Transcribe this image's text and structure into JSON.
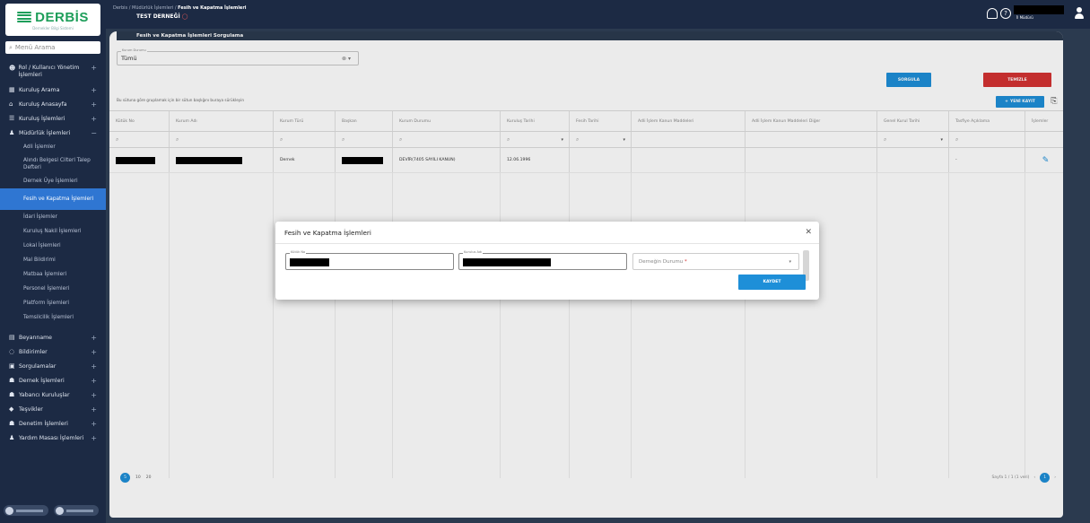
{
  "sidebar": {
    "logo_text": "DERBİS",
    "logo_sub": "Dernekler Bilgi Sistemi",
    "search_placeholder": "Menü Arama",
    "items": [
      {
        "label": "Rol / Kullanıcı Yönetim İşlemleri",
        "icon": "users-icon"
      },
      {
        "label": "Kuruluş Arama",
        "icon": "building-icon"
      },
      {
        "label": "Kuruluş Anasayfa",
        "icon": "home-icon"
      },
      {
        "label": "Kuruluş İşlemleri",
        "icon": "list-icon"
      },
      {
        "label": "Müdürlük İşlemleri",
        "icon": "person-icon"
      }
    ],
    "subitems": [
      "Adli İşlemler",
      "Alındı Belgesi Cilteri Talep Defteri",
      "Dernek Üye İşlemleri",
      "Fesih ve Kapatma İşlemleri",
      "İdari İşlemler",
      "Kuruluş Nakil İşlemleri",
      "Lokal İşlemleri",
      "Mal Bildirimi",
      "Matbaa İşlemleri",
      "Personel İşlemleri",
      "Platform İşlemleri",
      "Temsilcilik İşlemleri"
    ],
    "items2": [
      {
        "label": "Beyanname",
        "icon": "doc-icon"
      },
      {
        "label": "Bildirimler",
        "icon": "bell-icon"
      },
      {
        "label": "Sorgulamalar",
        "icon": "search-doc-icon"
      },
      {
        "label": "Dernek İşlemleri",
        "icon": "group-icon"
      },
      {
        "label": "Yabancı Kuruluşlar",
        "icon": "globe-icon"
      },
      {
        "label": "Teşvikler",
        "icon": "handshake-icon"
      },
      {
        "label": "Denetim İşlemleri",
        "icon": "audit-icon"
      },
      {
        "label": "Yardım Masası İşlemleri",
        "icon": "help-desk-icon"
      }
    ]
  },
  "topbar": {
    "breadcrumb_1": "Derbis",
    "breadcrumb_2": "Müdürlük İşlemleri",
    "breadcrumb_3": "Fesih ve Kapatma İşlemleri",
    "organization": "TEST DERNEĞİ",
    "user_role": "İl Müdürü"
  },
  "panel": {
    "title": "Fesih ve Kapatma İşlemleri Sorgulama",
    "filter_label": "Kurum Durumu",
    "filter_value": "Tümü",
    "sorgula_label": "SORGULA",
    "temizle_label": "TEMİZLE",
    "group_hint": "Bu sütuna göre gruplamak için bir sütun başlığını buraya sürükleyin",
    "yeni_kayit_label": "YENİ KAYIT"
  },
  "table": {
    "columns": [
      "Kütük No",
      "Kurum Adı",
      "Kurum Türü",
      "Başkan",
      "Kurum Durumu",
      "Kuruluş Tarihi",
      "Fesih Tarihi",
      "Adli İşlem Kanun Maddeleri",
      "Adli İşlem Kanun Maddeleri Diğer",
      "Genel Kurul Tarihi",
      "Tasfiye Açıklama",
      "İşlemler"
    ],
    "row": {
      "kurum_turu": "Dernek",
      "kurum_durumu": "DEVİR(7405 SAYILI KANUN)",
      "kurulus_tarihi": "12.06.1996",
      "tasfiye": "-"
    }
  },
  "pager": {
    "sizes": [
      "5",
      "10",
      "20"
    ],
    "active_page": "1",
    "page_info": "Sayfa 1 / 1 (1 veri)"
  },
  "modal": {
    "title": "Fesih ve Kapatma İşlemleri",
    "field1_label": "Kütük No",
    "field2_label": "Kurulus Adı",
    "field3_placeholder": "Derneğin Durumu",
    "field3_required": "*",
    "save_label": "KAYDET"
  }
}
